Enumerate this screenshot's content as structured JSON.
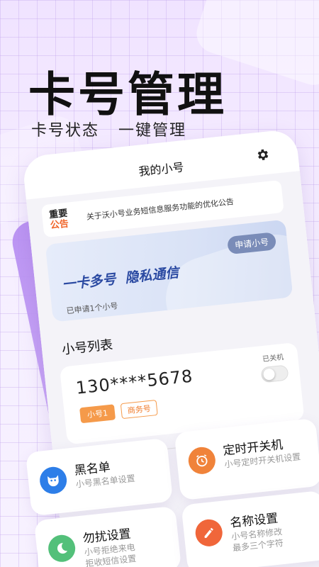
{
  "hero": {
    "title": "卡号管理",
    "subtitle": "卡号状态   一键管理"
  },
  "phone": {
    "title": "我的小号",
    "notice": {
      "badge_line1": "重要",
      "badge_line2": "公告",
      "text": "关于沃小号业务短信息服务功能的优化公告"
    },
    "banner": {
      "title": "一卡多号  隐私通信",
      "apply_button": "申请小号",
      "count_text": "已申请1个小号"
    },
    "list_title": "小号列表",
    "numbers": [
      {
        "number": "130****5678",
        "status": "已关机",
        "tag_primary": "小号1",
        "tag_secondary": "商务号",
        "powered_on": false
      }
    ]
  },
  "features": [
    {
      "title": "黑名单",
      "desc_line1": "小号黑名单设置",
      "desc_line2": "",
      "icon": "cat-mask-icon",
      "color": "#2d7ee8"
    },
    {
      "title": "定时开关机",
      "desc_line1": "小号定时开关机设置",
      "desc_line2": "",
      "icon": "alarm-clock-icon",
      "color": "#f0833a"
    },
    {
      "title": "勿扰设置",
      "desc_line1": "小号拒绝来电",
      "desc_line2": "拒收短信设置",
      "icon": "moon-icon",
      "color": "#53c07a"
    },
    {
      "title": "名称设置",
      "desc_line1": "小号名称修改",
      "desc_line2": "最多三个字符",
      "icon": "pencil-icon",
      "color": "#f0663a"
    }
  ]
}
